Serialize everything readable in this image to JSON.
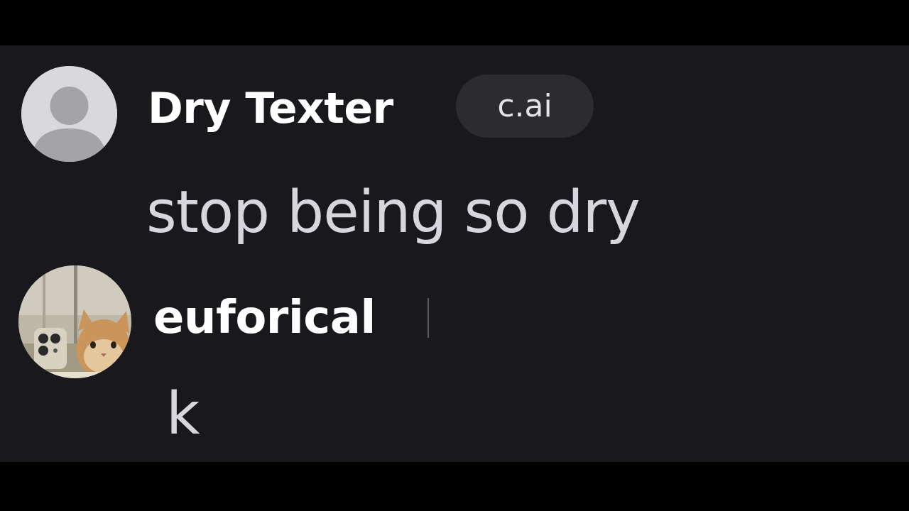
{
  "messages": [
    {
      "sender": "Dry Texter",
      "badge": "c.ai",
      "text": "stop being so dry",
      "avatar": "default-person-icon"
    },
    {
      "sender": "euforical",
      "text": "k",
      "avatar": "cat-photo-avatar"
    }
  ],
  "colors": {
    "background": "#18181d",
    "letterbox": "#000000",
    "name": "#ffffff",
    "message_text": "#d6d6dc",
    "badge_bg": "#2b2b30"
  }
}
